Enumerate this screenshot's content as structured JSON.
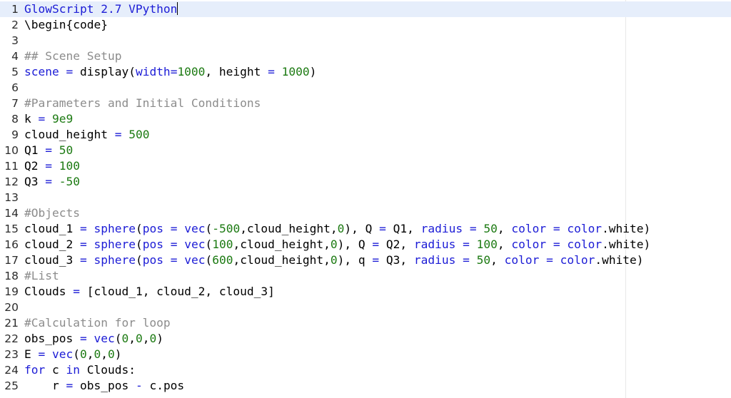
{
  "editor": {
    "lines": [
      {
        "n": "1",
        "tokens": [
          {
            "t": "GlowScript 2.7 VPython",
            "c": "kw"
          }
        ],
        "active": true,
        "caret": true
      },
      {
        "n": "2",
        "tokens": [
          {
            "t": "\\begin{code}",
            "c": "id"
          }
        ]
      },
      {
        "n": "3",
        "tokens": []
      },
      {
        "n": "4",
        "tokens": [
          {
            "t": "## Scene Setup",
            "c": "cm"
          }
        ]
      },
      {
        "n": "5",
        "tokens": [
          {
            "t": "scene",
            "c": "kw"
          },
          {
            "t": " = ",
            "c": "op"
          },
          {
            "t": "display(",
            "c": "id"
          },
          {
            "t": "width",
            "c": "kw"
          },
          {
            "t": "=",
            "c": "op"
          },
          {
            "t": "1000",
            "c": "num"
          },
          {
            "t": ", height ",
            "c": "id"
          },
          {
            "t": "=",
            "c": "op"
          },
          {
            "t": " ",
            "c": "id"
          },
          {
            "t": "1000",
            "c": "num"
          },
          {
            "t": ")",
            "c": "id"
          }
        ]
      },
      {
        "n": "6",
        "tokens": []
      },
      {
        "n": "7",
        "tokens": [
          {
            "t": "#Parameters and Initial Conditions",
            "c": "cm"
          }
        ]
      },
      {
        "n": "8",
        "tokens": [
          {
            "t": "k ",
            "c": "id"
          },
          {
            "t": "=",
            "c": "op"
          },
          {
            "t": " ",
            "c": "id"
          },
          {
            "t": "9e9",
            "c": "num"
          }
        ]
      },
      {
        "n": "9",
        "tokens": [
          {
            "t": "cloud_height ",
            "c": "id"
          },
          {
            "t": "=",
            "c": "op"
          },
          {
            "t": " ",
            "c": "id"
          },
          {
            "t": "500",
            "c": "num"
          }
        ]
      },
      {
        "n": "10",
        "tokens": [
          {
            "t": "Q1 ",
            "c": "id"
          },
          {
            "t": "=",
            "c": "op"
          },
          {
            "t": " ",
            "c": "id"
          },
          {
            "t": "50",
            "c": "num"
          }
        ]
      },
      {
        "n": "11",
        "tokens": [
          {
            "t": "Q2 ",
            "c": "id"
          },
          {
            "t": "=",
            "c": "op"
          },
          {
            "t": " ",
            "c": "id"
          },
          {
            "t": "100",
            "c": "num"
          }
        ]
      },
      {
        "n": "12",
        "tokens": [
          {
            "t": "Q3 ",
            "c": "id"
          },
          {
            "t": "=",
            "c": "op"
          },
          {
            "t": " ",
            "c": "id"
          },
          {
            "t": "-50",
            "c": "num"
          }
        ]
      },
      {
        "n": "13",
        "tokens": []
      },
      {
        "n": "14",
        "tokens": [
          {
            "t": "#Objects",
            "c": "cm"
          }
        ]
      },
      {
        "n": "15",
        "tokens": [
          {
            "t": "cloud_1 ",
            "c": "id"
          },
          {
            "t": "=",
            "c": "op"
          },
          {
            "t": " ",
            "c": "id"
          },
          {
            "t": "sphere",
            "c": "kw"
          },
          {
            "t": "(",
            "c": "id"
          },
          {
            "t": "pos",
            "c": "kw"
          },
          {
            "t": " = ",
            "c": "op"
          },
          {
            "t": "vec",
            "c": "kw"
          },
          {
            "t": "(",
            "c": "id"
          },
          {
            "t": "-500",
            "c": "num"
          },
          {
            "t": ",cloud_height,",
            "c": "id"
          },
          {
            "t": "0",
            "c": "num"
          },
          {
            "t": "), Q ",
            "c": "id"
          },
          {
            "t": "=",
            "c": "op"
          },
          {
            "t": " Q1, ",
            "c": "id"
          },
          {
            "t": "radius",
            "c": "kw"
          },
          {
            "t": " = ",
            "c": "op"
          },
          {
            "t": "50",
            "c": "num"
          },
          {
            "t": ", ",
            "c": "id"
          },
          {
            "t": "color",
            "c": "kw"
          },
          {
            "t": " = ",
            "c": "op"
          },
          {
            "t": "color",
            "c": "kw"
          },
          {
            "t": ".white)",
            "c": "id"
          }
        ]
      },
      {
        "n": "16",
        "tokens": [
          {
            "t": "cloud_2 ",
            "c": "id"
          },
          {
            "t": "=",
            "c": "op"
          },
          {
            "t": " ",
            "c": "id"
          },
          {
            "t": "sphere",
            "c": "kw"
          },
          {
            "t": "(",
            "c": "id"
          },
          {
            "t": "pos",
            "c": "kw"
          },
          {
            "t": " = ",
            "c": "op"
          },
          {
            "t": "vec",
            "c": "kw"
          },
          {
            "t": "(",
            "c": "id"
          },
          {
            "t": "100",
            "c": "num"
          },
          {
            "t": ",cloud_height,",
            "c": "id"
          },
          {
            "t": "0",
            "c": "num"
          },
          {
            "t": "), Q ",
            "c": "id"
          },
          {
            "t": "=",
            "c": "op"
          },
          {
            "t": " Q2, ",
            "c": "id"
          },
          {
            "t": "radius",
            "c": "kw"
          },
          {
            "t": " = ",
            "c": "op"
          },
          {
            "t": "100",
            "c": "num"
          },
          {
            "t": ", ",
            "c": "id"
          },
          {
            "t": "color",
            "c": "kw"
          },
          {
            "t": " = ",
            "c": "op"
          },
          {
            "t": "color",
            "c": "kw"
          },
          {
            "t": ".white)",
            "c": "id"
          }
        ]
      },
      {
        "n": "17",
        "tokens": [
          {
            "t": "cloud_3 ",
            "c": "id"
          },
          {
            "t": "=",
            "c": "op"
          },
          {
            "t": " ",
            "c": "id"
          },
          {
            "t": "sphere",
            "c": "kw"
          },
          {
            "t": "(",
            "c": "id"
          },
          {
            "t": "pos",
            "c": "kw"
          },
          {
            "t": " = ",
            "c": "op"
          },
          {
            "t": "vec",
            "c": "kw"
          },
          {
            "t": "(",
            "c": "id"
          },
          {
            "t": "600",
            "c": "num"
          },
          {
            "t": ",cloud_height,",
            "c": "id"
          },
          {
            "t": "0",
            "c": "num"
          },
          {
            "t": "), q ",
            "c": "id"
          },
          {
            "t": "=",
            "c": "op"
          },
          {
            "t": " Q3, ",
            "c": "id"
          },
          {
            "t": "radius",
            "c": "kw"
          },
          {
            "t": " = ",
            "c": "op"
          },
          {
            "t": "50",
            "c": "num"
          },
          {
            "t": ", ",
            "c": "id"
          },
          {
            "t": "color",
            "c": "kw"
          },
          {
            "t": " = ",
            "c": "op"
          },
          {
            "t": "color",
            "c": "kw"
          },
          {
            "t": ".white)",
            "c": "id"
          }
        ]
      },
      {
        "n": "18",
        "tokens": [
          {
            "t": "#List",
            "c": "cm"
          }
        ]
      },
      {
        "n": "19",
        "tokens": [
          {
            "t": "Clouds ",
            "c": "id"
          },
          {
            "t": "=",
            "c": "op"
          },
          {
            "t": " [cloud_1, cloud_2, cloud_3]",
            "c": "id"
          }
        ]
      },
      {
        "n": "20",
        "tokens": []
      },
      {
        "n": "21",
        "tokens": [
          {
            "t": "#Calculation for loop",
            "c": "cm"
          }
        ]
      },
      {
        "n": "22",
        "tokens": [
          {
            "t": "obs_pos ",
            "c": "id"
          },
          {
            "t": "=",
            "c": "op"
          },
          {
            "t": " ",
            "c": "id"
          },
          {
            "t": "vec",
            "c": "kw"
          },
          {
            "t": "(",
            "c": "id"
          },
          {
            "t": "0",
            "c": "num"
          },
          {
            "t": ",",
            "c": "id"
          },
          {
            "t": "0",
            "c": "num"
          },
          {
            "t": ",",
            "c": "id"
          },
          {
            "t": "0",
            "c": "num"
          },
          {
            "t": ")",
            "c": "id"
          }
        ]
      },
      {
        "n": "23",
        "tokens": [
          {
            "t": "E ",
            "c": "id"
          },
          {
            "t": "=",
            "c": "op"
          },
          {
            "t": " ",
            "c": "id"
          },
          {
            "t": "vec",
            "c": "kw"
          },
          {
            "t": "(",
            "c": "id"
          },
          {
            "t": "0",
            "c": "num"
          },
          {
            "t": ",",
            "c": "id"
          },
          {
            "t": "0",
            "c": "num"
          },
          {
            "t": ",",
            "c": "id"
          },
          {
            "t": "0",
            "c": "num"
          },
          {
            "t": ")",
            "c": "id"
          }
        ]
      },
      {
        "n": "24",
        "tokens": [
          {
            "t": "for",
            "c": "kw"
          },
          {
            "t": " c ",
            "c": "id"
          },
          {
            "t": "in",
            "c": "kw"
          },
          {
            "t": " Clouds:",
            "c": "id"
          }
        ]
      },
      {
        "n": "25",
        "tokens": [
          {
            "t": "    r ",
            "c": "id"
          },
          {
            "t": "=",
            "c": "op"
          },
          {
            "t": " obs_pos ",
            "c": "id"
          },
          {
            "t": "-",
            "c": "op"
          },
          {
            "t": " c.pos",
            "c": "id"
          }
        ]
      }
    ]
  },
  "colors": {
    "keyword": "#1c1cd6",
    "number": "#1c7a12",
    "comment": "#8c8c8c",
    "active_line": "#e6eefb"
  }
}
